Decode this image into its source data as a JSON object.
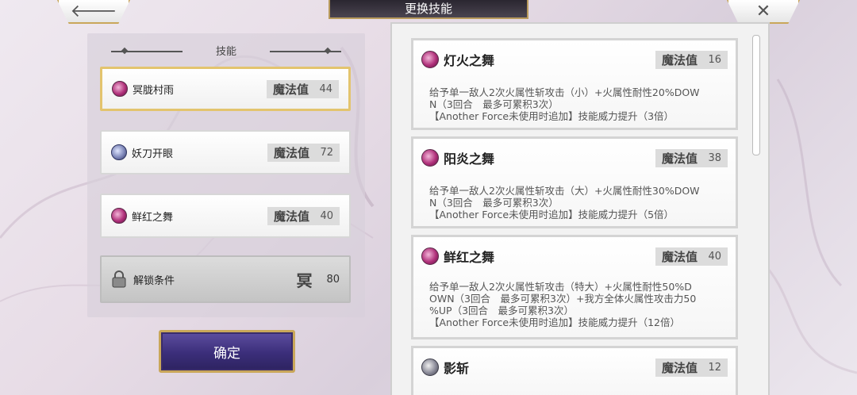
{
  "header": {
    "title": "更换技能"
  },
  "left_panel": {
    "title": "技能",
    "slots": [
      {
        "name": "冥胧村雨",
        "mp_label": "魔法值",
        "mp": "44",
        "icon": "purple-orb-icon",
        "selected": true
      },
      {
        "name": "妖刀开眼",
        "mp_label": "魔法值",
        "mp": "72",
        "icon": "blue-snowflake-icon"
      },
      {
        "name": "鲜红之舞",
        "mp_label": "魔法值",
        "mp": "40",
        "icon": "purple-orb-icon"
      },
      {
        "name": "解锁条件",
        "kanji": "冥",
        "value": "80",
        "icon": "lock-icon",
        "locked": true
      }
    ],
    "confirm_label": "确定"
  },
  "skill_list": [
    {
      "name": "灯火之舞",
      "mp_label": "魔法值",
      "mp": "16",
      "desc": [
        "给予单一敌人2次火属性斩攻击（小）+火属性耐性20%DOW",
        "N（3回合　最多可累积3次）",
        "【Another Force未使用时追加】技能威力提升（3倍）"
      ]
    },
    {
      "name": "阳炎之舞",
      "mp_label": "魔法值",
      "mp": "38",
      "desc": [
        "给予单一敌人2次火属性斩攻击（大）+火属性耐性30%DOW",
        "N（3回合　最多可累积3次）",
        "【Another Force未使用时追加】技能威力提升（5倍）"
      ]
    },
    {
      "name": "鲜红之舞",
      "mp_label": "魔法值",
      "mp": "40",
      "desc": [
        "给予单一敌人2次火属性斩攻击（特大）+火属性耐性50%D",
        "OWN（3回合　最多可累积3次）+我方全体火属性攻击力50",
        "%UP（3回合　最多可累积3次）",
        "【Another Force未使用时追加】技能威力提升（12倍）"
      ]
    },
    {
      "name": "影斩",
      "mp_label": "魔法值",
      "mp": "12",
      "desc": []
    }
  ],
  "colors": {
    "gold_border": "#e3c46e",
    "confirm_bg": "#3b2e7a",
    "mp_box": "#dcdcdc"
  }
}
